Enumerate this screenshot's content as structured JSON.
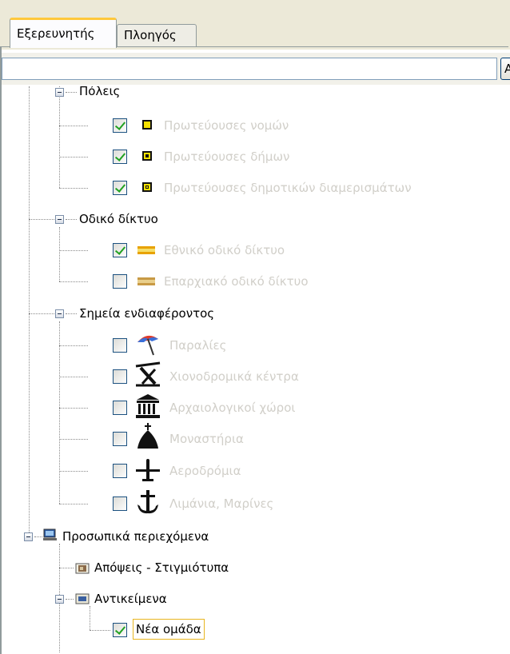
{
  "tabs": [
    {
      "label": "Εξερευνητής",
      "active": true
    },
    {
      "label": "Πλοηγός",
      "active": false
    }
  ],
  "search": {
    "value": "",
    "button_label": "Αναζήτηση"
  },
  "tree": {
    "cities_group": {
      "label": "Πόλεις",
      "items": [
        {
          "label": "Πρωτεύουσες νομών",
          "checked": true,
          "symbol": "yellow-square-icon"
        },
        {
          "label": "Πρωτεύουσες δήμων",
          "checked": true,
          "symbol": "yellow-square-dot-icon"
        },
        {
          "label": "Πρωτεύουσες δημοτικών διαμερισμάτων",
          "checked": true,
          "symbol": "yellow-square-inner-icon"
        }
      ]
    },
    "road_group": {
      "label": "Οδικό δίκτυο",
      "items": [
        {
          "label": "Εθνικό οδικό δίκτυο",
          "checked": true,
          "symbol": "national-road-icon"
        },
        {
          "label": "Επαρχιακό οδικό δίκτυο",
          "checked": false,
          "symbol": "provincial-road-icon"
        }
      ]
    },
    "poi_group": {
      "label": "Σημεία ενδιαφέροντος",
      "items": [
        {
          "label": "Παραλίες",
          "checked": false,
          "symbol": "beach-umbrella-icon"
        },
        {
          "label": "Χιονοδρομικά κέντρα",
          "checked": false,
          "symbol": "ski-lift-icon"
        },
        {
          "label": "Αρχαιολογικοί χώροι",
          "checked": false,
          "symbol": "temple-icon"
        },
        {
          "label": "Μοναστήρια",
          "checked": false,
          "symbol": "monastery-icon"
        },
        {
          "label": "Αεροδρόμια",
          "checked": false,
          "symbol": "airplane-icon"
        },
        {
          "label": "Λιμάνια, Μαρίνες",
          "checked": false,
          "symbol": "anchor-icon"
        }
      ]
    },
    "personal": {
      "label": "Προσωπικά περιεχόμενα",
      "views_label": "Απόψεις - Στιγμιότυπα",
      "objects_label": "Αντικείμενα",
      "new_group_label": "Νέα ομάδα",
      "new_group_checked": true
    }
  },
  "colors": {
    "tab_accent": "#ffc83c",
    "check": "#21a121",
    "dim_text": "#d1cfc9",
    "tab_bg": "#ece9d8"
  }
}
